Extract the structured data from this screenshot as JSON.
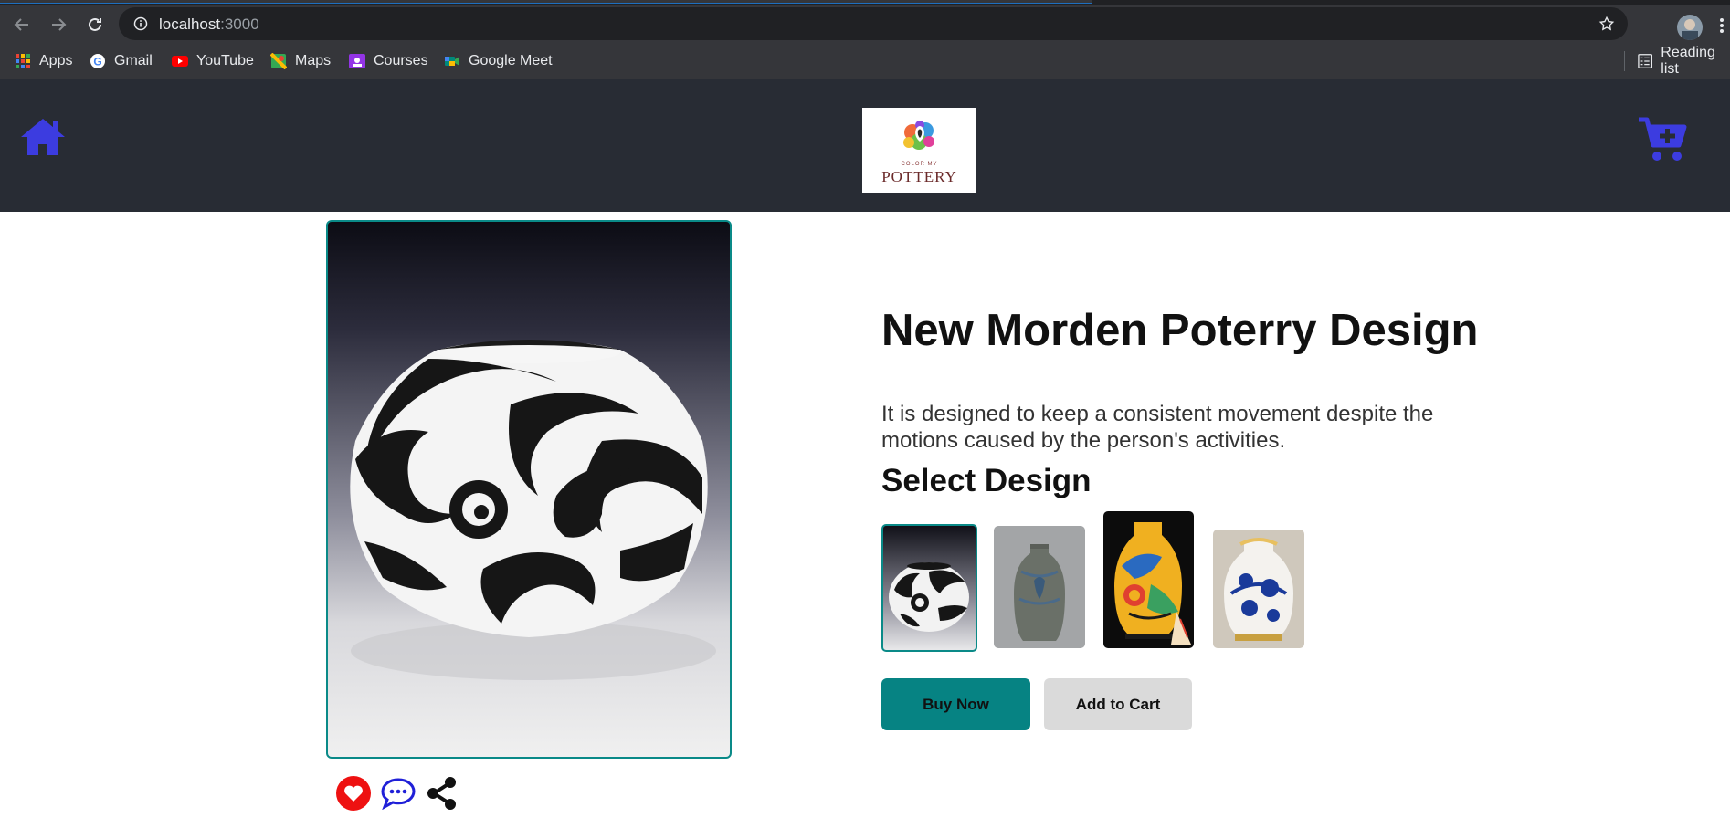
{
  "browser": {
    "url_host": "localhost",
    "url_port": ":3000",
    "bookmarks": [
      "Apps",
      "Gmail",
      "YouTube",
      "Maps",
      "Courses",
      "Google Meet"
    ],
    "reading_list": "Reading list"
  },
  "header": {
    "logo_small": "COLOR MY",
    "logo_big": "POTTERY"
  },
  "product": {
    "title": "New Morden Poterry Design",
    "description": "It is designed to keep a consistent movement despite the motions caused by the person's activities.",
    "select_heading": "Select Design",
    "designs": [
      "swirl-vase",
      "bronze-vase",
      "yellow-art-vase",
      "blue-white-vase"
    ],
    "selected_design": 0
  },
  "actions": {
    "buy_now": "Buy Now",
    "add_to_cart": "Add to Cart"
  },
  "colors": {
    "accent": "#068383",
    "header_bg": "#282c34",
    "icon_blue": "#3c3ce0"
  },
  "icons": [
    "home-icon",
    "cart-plus-icon",
    "heart-icon",
    "comment-icon",
    "share-icon"
  ]
}
